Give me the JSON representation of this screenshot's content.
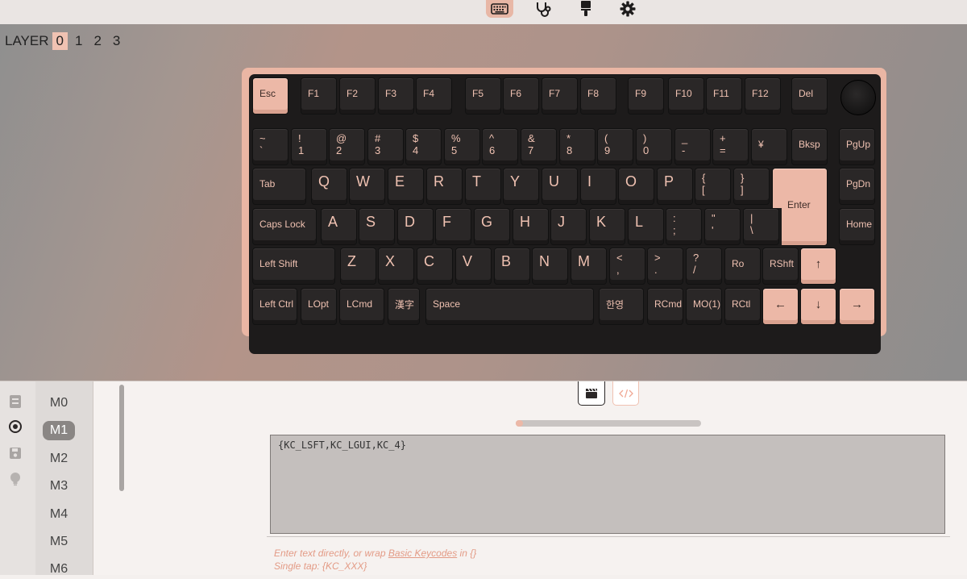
{
  "nav": {
    "tabs": [
      {
        "name": "configure",
        "icon": "keyboard-icon",
        "active": true
      },
      {
        "name": "test",
        "icon": "stethoscope-icon",
        "active": false
      },
      {
        "name": "design",
        "icon": "brush-icon",
        "active": false
      },
      {
        "name": "settings",
        "icon": "gear-icon",
        "active": false
      }
    ]
  },
  "layers": {
    "label": "LAYER",
    "items": [
      "0",
      "1",
      "2",
      "3"
    ],
    "active": "0"
  },
  "keyboard": {
    "knob": "rotary-knob",
    "rows": [
      [
        {
          "label": "Esc",
          "highlight": true
        },
        {
          "label": "F1"
        },
        {
          "label": "F2"
        },
        {
          "label": "F3"
        },
        {
          "label": "F4"
        },
        {
          "label": "F5"
        },
        {
          "label": "F6"
        },
        {
          "label": "F7"
        },
        {
          "label": "F8"
        },
        {
          "label": "F9"
        },
        {
          "label": "F10"
        },
        {
          "label": "F11"
        },
        {
          "label": "F12"
        },
        {
          "label": "Del"
        }
      ],
      [
        {
          "top": "~",
          "bottom": "`"
        },
        {
          "top": "!",
          "bottom": "1"
        },
        {
          "top": "@",
          "bottom": "2"
        },
        {
          "top": "#",
          "bottom": "3"
        },
        {
          "top": "$",
          "bottom": "4"
        },
        {
          "top": "%",
          "bottom": "5"
        },
        {
          "top": "^",
          "bottom": "6"
        },
        {
          "top": "&",
          "bottom": "7"
        },
        {
          "top": "*",
          "bottom": "8"
        },
        {
          "top": "(",
          "bottom": "9"
        },
        {
          "top": ")",
          "bottom": "0"
        },
        {
          "top": "_",
          "bottom": "-"
        },
        {
          "top": "+",
          "bottom": "="
        },
        {
          "label": "¥"
        },
        {
          "label": "Bksp"
        },
        {
          "label": "PgUp"
        }
      ],
      [
        {
          "label": "Tab"
        },
        {
          "label": "Q"
        },
        {
          "label": "W"
        },
        {
          "label": "E"
        },
        {
          "label": "R"
        },
        {
          "label": "T"
        },
        {
          "label": "Y"
        },
        {
          "label": "U"
        },
        {
          "label": "I"
        },
        {
          "label": "O"
        },
        {
          "label": "P"
        },
        {
          "top": "{",
          "bottom": "["
        },
        {
          "top": "}",
          "bottom": "]"
        },
        {
          "label": "Enter",
          "highlight": true
        },
        {
          "label": "PgDn"
        }
      ],
      [
        {
          "label": "Caps Lock"
        },
        {
          "label": "A"
        },
        {
          "label": "S"
        },
        {
          "label": "D"
        },
        {
          "label": "F"
        },
        {
          "label": "G"
        },
        {
          "label": "H"
        },
        {
          "label": "J"
        },
        {
          "label": "K"
        },
        {
          "label": "L"
        },
        {
          "top": ":",
          "bottom": ";"
        },
        {
          "top": "\"",
          "bottom": "'"
        },
        {
          "top": "|",
          "bottom": "\\"
        },
        {
          "label": "Home"
        }
      ],
      [
        {
          "label": "Left Shift"
        },
        {
          "label": "Z"
        },
        {
          "label": "X"
        },
        {
          "label": "C"
        },
        {
          "label": "V"
        },
        {
          "label": "B"
        },
        {
          "label": "N"
        },
        {
          "label": "M"
        },
        {
          "top": "<",
          "bottom": ","
        },
        {
          "top": ">",
          "bottom": "."
        },
        {
          "top": "?",
          "bottom": "/"
        },
        {
          "label": "Ro"
        },
        {
          "label": "RShft"
        },
        {
          "label": "↑",
          "highlight": true
        }
      ],
      [
        {
          "label": "Left Ctrl"
        },
        {
          "label": "LOpt"
        },
        {
          "label": "LCmd"
        },
        {
          "label": "漢字"
        },
        {
          "label": "Space"
        },
        {
          "label": "한영"
        },
        {
          "label": "RCmd"
        },
        {
          "label": "MO(1)"
        },
        {
          "label": "RCtl"
        },
        {
          "label": "←",
          "highlight": true
        },
        {
          "label": "↓",
          "highlight": true
        },
        {
          "label": "→",
          "highlight": true
        }
      ]
    ]
  },
  "bottom": {
    "rail_icons": [
      "keycodes-icon",
      "macro-icon",
      "save-icon",
      "lightbulb-icon"
    ],
    "macros": [
      "M0",
      "M1",
      "M2",
      "M3",
      "M4",
      "M5",
      "M6"
    ],
    "active_macro": "M1",
    "mode_buttons": [
      {
        "name": "recorder",
        "icon": "clapperboard-icon",
        "active": true
      },
      {
        "name": "script",
        "icon": "code-icon",
        "active": false
      }
    ],
    "progress": 0.04,
    "macro_text": "{KC_LSFT,KC_LGUI,KC_4}",
    "hint_line1_prefix": "Enter text directly, or wrap ",
    "hint_line1_link": "Basic Keycodes",
    "hint_line1_suffix": " in {}",
    "hint_line2": "Single tap: {KC_XXX}"
  }
}
